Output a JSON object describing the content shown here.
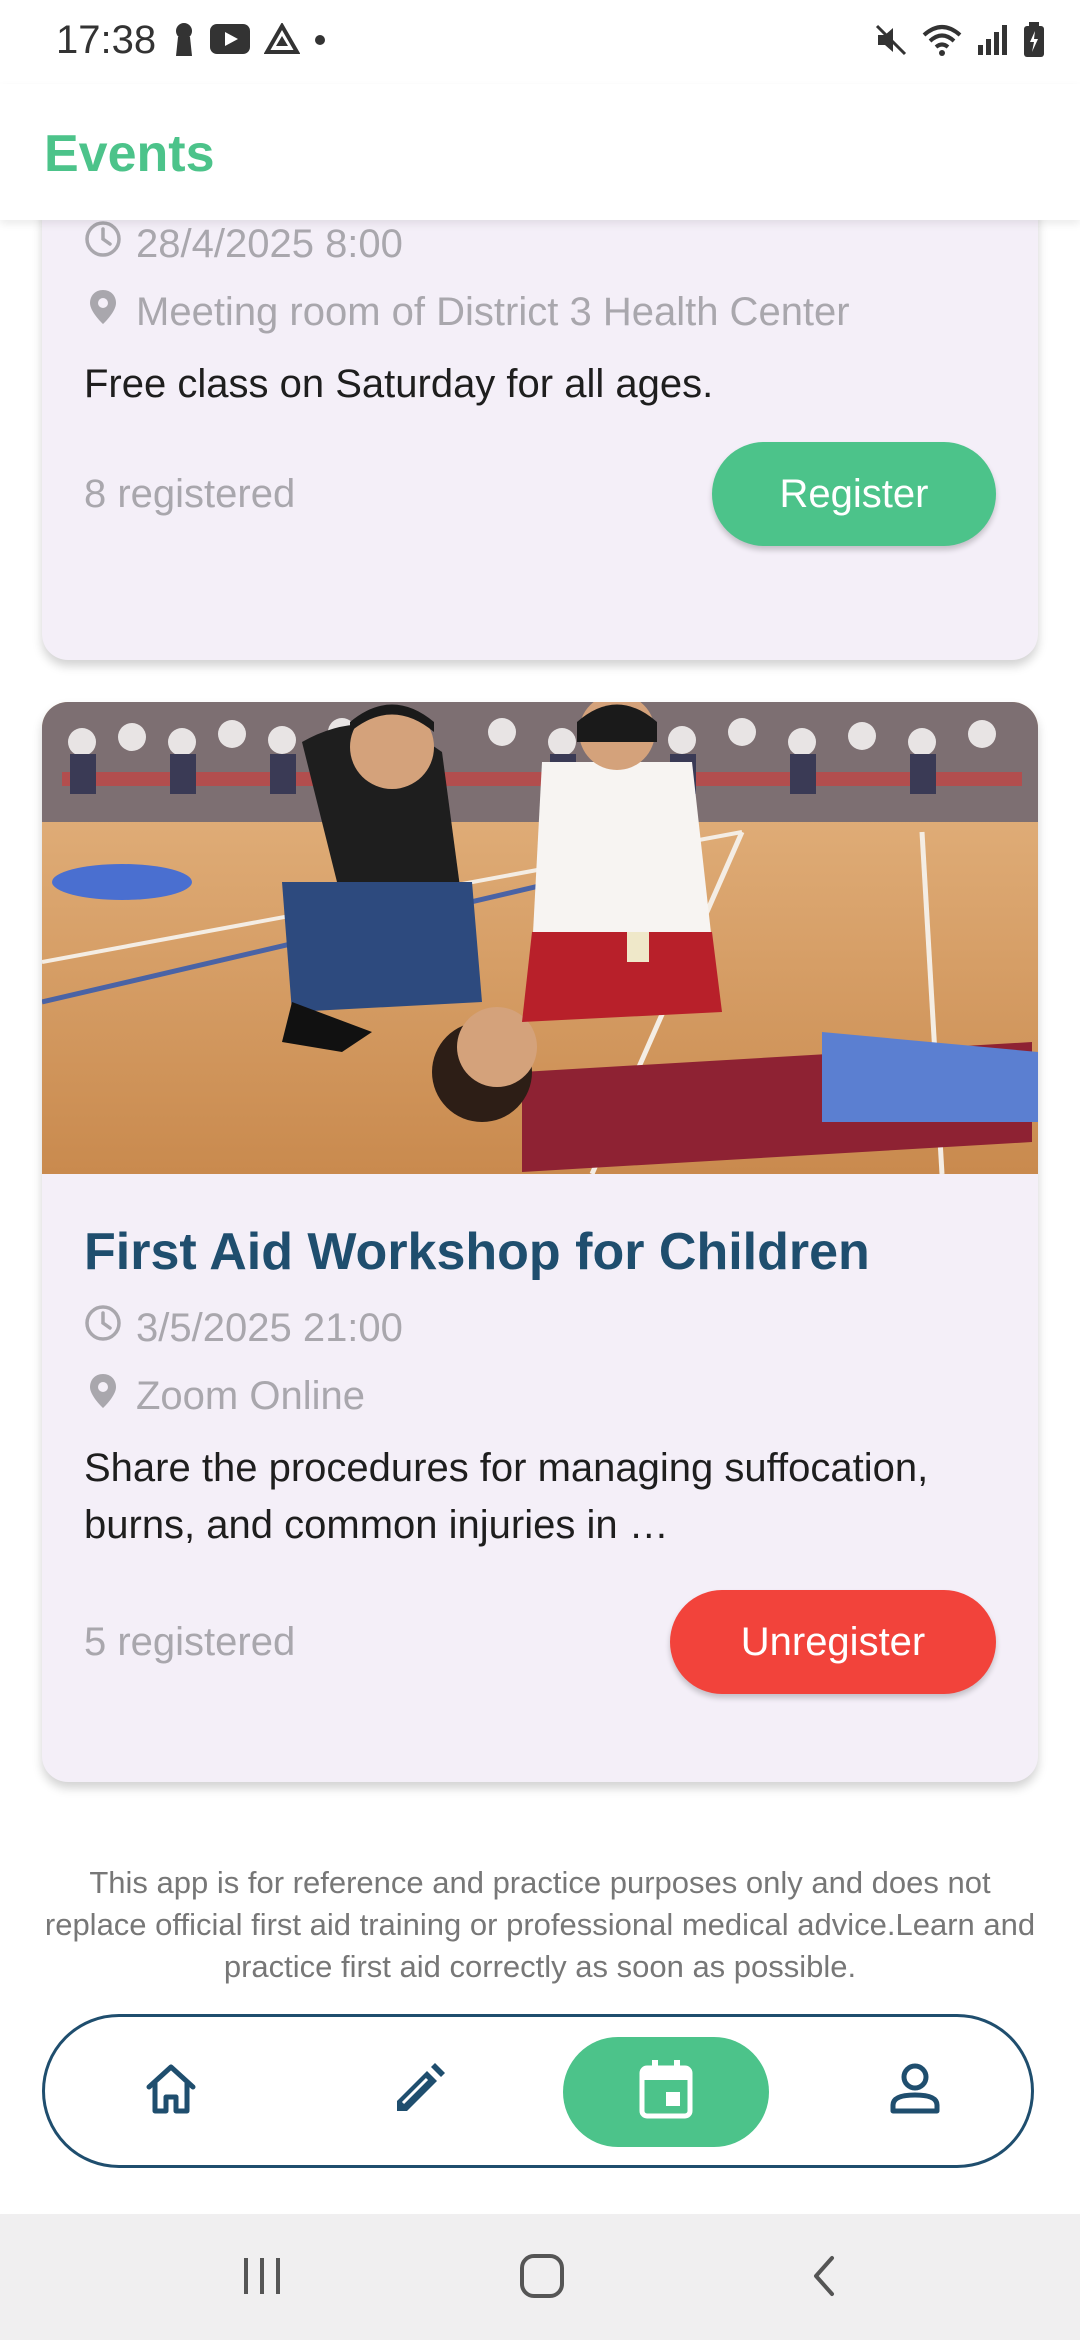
{
  "status": {
    "time": "17:38"
  },
  "header": {
    "title": "Events"
  },
  "events": [
    {
      "datetime": "28/4/2025 8:00",
      "location": "Meeting room of District 3 Health Center",
      "description": "Free class on Saturday for all ages.",
      "registered": "8 registered",
      "action": "Register"
    },
    {
      "title": "First Aid Workshop for Children",
      "datetime": "3/5/2025 21:00",
      "location": "Zoom Online",
      "description": "Share the procedures for managing suffocation, burns, and common injuries in …",
      "registered": "5 registered",
      "action": "Unregister"
    }
  ],
  "disclaimer": "This app is for reference and practice purposes only and does not replace official first aid training or professional medical advice.Learn and practice first aid correctly as soon as possible.",
  "nav": {
    "items": [
      "home-icon",
      "edit-icon",
      "calendar-icon",
      "profile-icon"
    ],
    "active": "calendar-icon"
  },
  "colors": {
    "accent": "#4cc38a",
    "title": "#1f4e6e",
    "danger": "#f2433b",
    "card": "#f4eff8"
  }
}
